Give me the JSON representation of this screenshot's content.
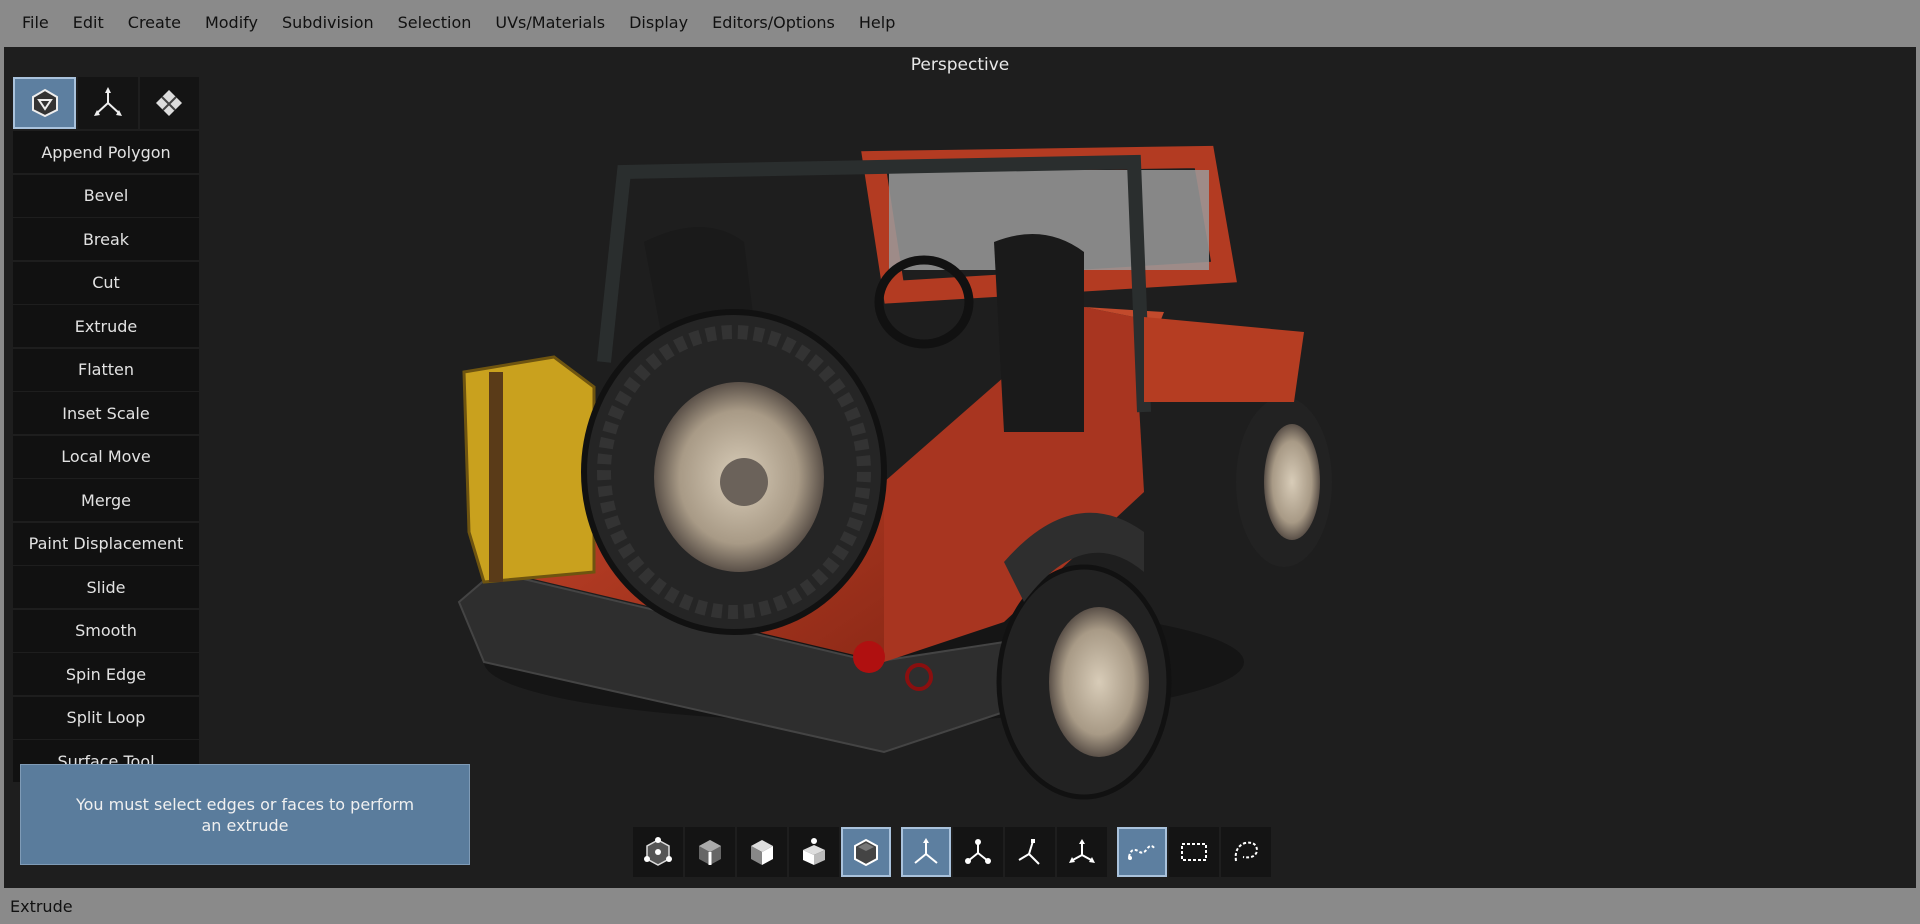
{
  "menubar": {
    "items": [
      "File",
      "Edit",
      "Create",
      "Modify",
      "Subdivision",
      "Selection",
      "UVs/Materials",
      "Display",
      "Editors/Options",
      "Help"
    ]
  },
  "viewport": {
    "title": "Perspective"
  },
  "mode_tabs": [
    {
      "icon": "polygon-cube-icon",
      "active": true
    },
    {
      "icon": "axis-transform-icon",
      "active": false
    },
    {
      "icon": "uv-diamond-icon",
      "active": false
    }
  ],
  "tools": [
    "Append Polygon",
    "Bevel",
    "Break",
    "Cut",
    "Extrude",
    "Flatten",
    "Inset Scale",
    "Local Move",
    "Merge",
    "Paint Displacement",
    "Slide",
    "Smooth",
    "Spin Edge",
    "Split Loop",
    "Surface Tool"
  ],
  "message": {
    "text": "You must select edges or faces to perform an extrude"
  },
  "bottom_toolbar": {
    "component_modes": [
      {
        "icon": "vertex-mode-icon",
        "active": false
      },
      {
        "icon": "edge-mode-icon",
        "active": false
      },
      {
        "icon": "face-mode-icon",
        "active": false
      },
      {
        "icon": "uv-mode-icon",
        "active": false
      },
      {
        "icon": "object-mode-icon",
        "active": true
      }
    ],
    "transform_modes": [
      {
        "icon": "world-axis-icon",
        "active": true
      },
      {
        "icon": "object-axis-icon",
        "active": false
      },
      {
        "icon": "local-axis-icon",
        "active": false
      },
      {
        "icon": "component-axis-icon",
        "active": false
      }
    ],
    "selection_modes": [
      {
        "icon": "lasso-paint-icon",
        "active": true
      },
      {
        "icon": "marquee-select-icon",
        "active": false
      },
      {
        "icon": "lasso-select-icon",
        "active": false
      }
    ]
  },
  "colors": {
    "accent": "#5d7fa0",
    "viewport_bg": "#1e1e1e",
    "chrome_bg": "#8a8a8a",
    "jeep_body": "#b83a22"
  },
  "statusbar": {
    "text": "Extrude"
  }
}
